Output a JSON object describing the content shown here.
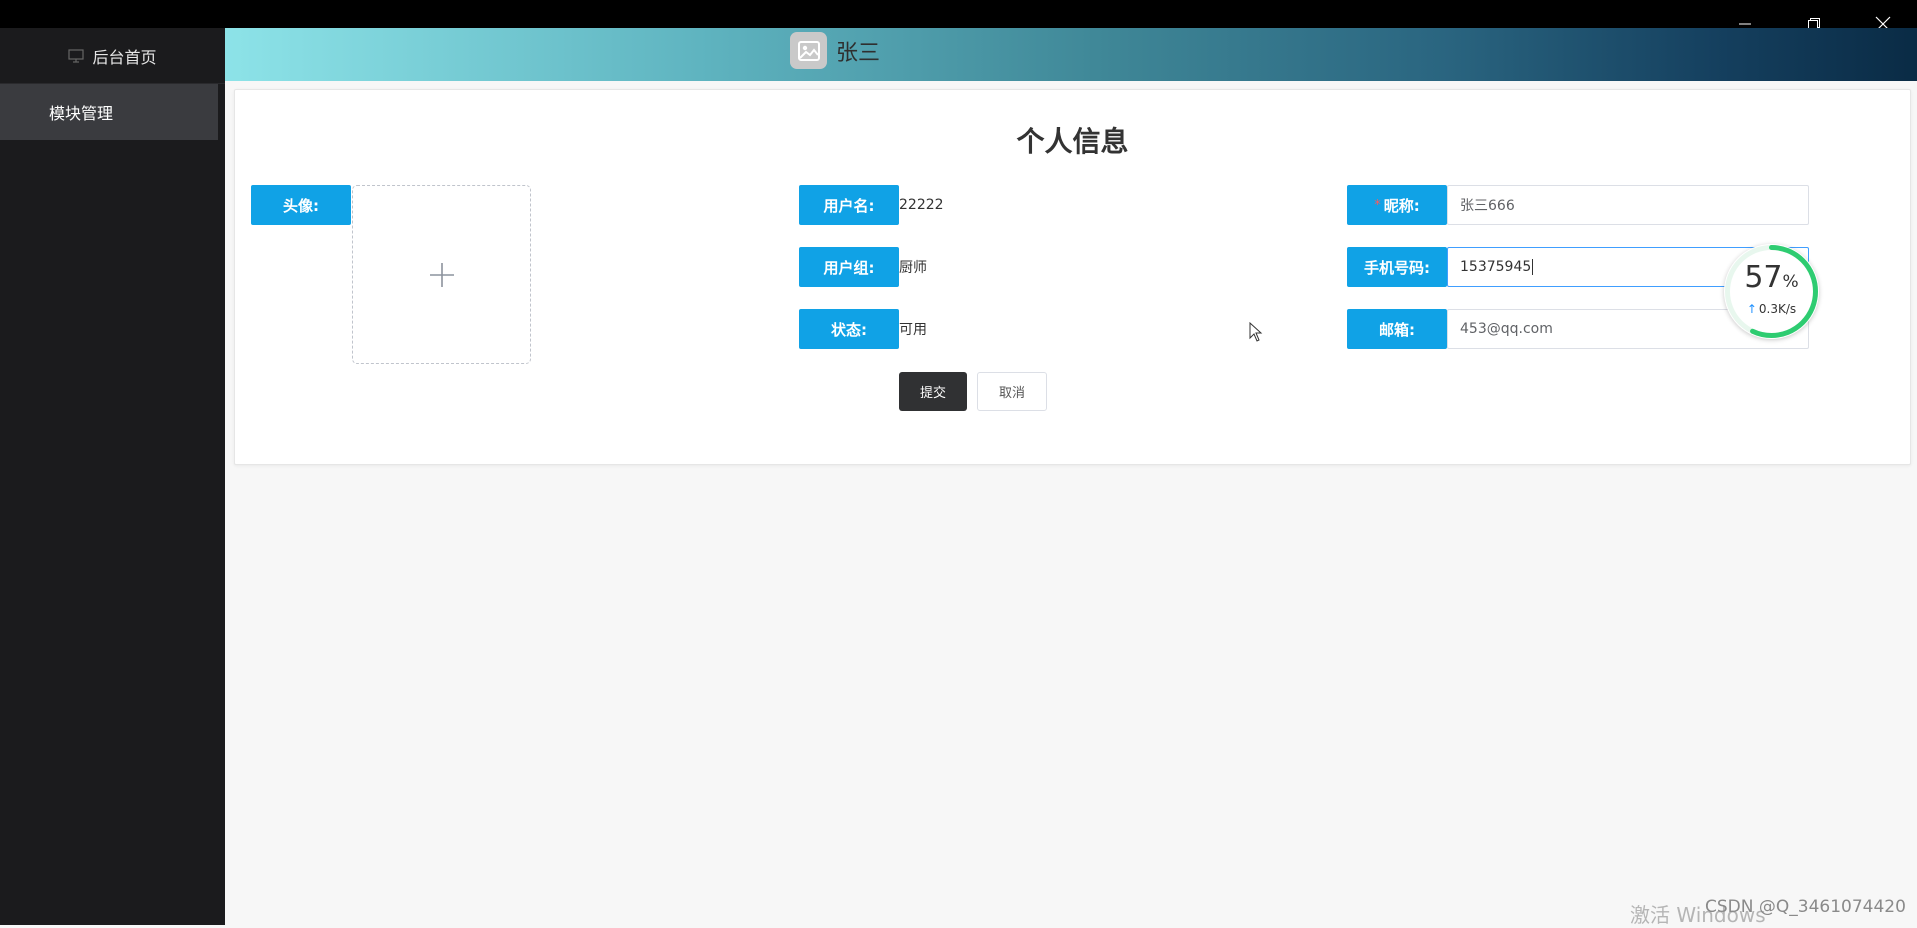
{
  "window": {
    "minimize_icon": "minimize-icon",
    "restore_icon": "restore-icon",
    "close_icon": "close-icon"
  },
  "sidebar": {
    "home_label": "后台首页",
    "home_icon": "monitor-icon",
    "items": [
      {
        "label": "模块管理"
      }
    ]
  },
  "header": {
    "user_name": "张三",
    "avatar_icon": "image-icon"
  },
  "form": {
    "title": "个人信息",
    "avatar_label": "头像:",
    "upload_icon": "plus-icon",
    "username_label": "用户名:",
    "username_value": "22222",
    "group_label": "用户组:",
    "group_value": "厨师",
    "status_label": "状态:",
    "status_value": "可用",
    "nickname_required_mark": "*",
    "nickname_label": "昵称:",
    "nickname_value": "张三666",
    "phone_label": "手机号码:",
    "phone_value": "15375945",
    "email_label": "邮箱:",
    "email_value": "453@qq.com",
    "submit_label": "提交",
    "cancel_label": "取消"
  },
  "speed_widget": {
    "percent": "57",
    "percent_unit": "%",
    "rate": "0.3K/s",
    "ring_color": "#2ecc71"
  },
  "watermarks": {
    "windows": "激活 Windows",
    "csdn": "CSDN @Q_3461074420"
  }
}
